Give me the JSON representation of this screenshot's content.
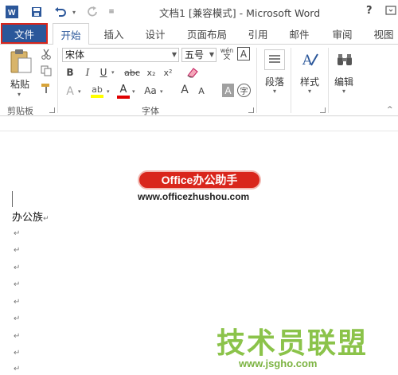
{
  "window": {
    "title": "文档1 [兼容模式] - Microsoft Word",
    "help": "?",
    "app_icon": "word-app-icon"
  },
  "quick_access": {
    "save_icon": "save-icon",
    "undo_icon": "undo-icon",
    "redo_icon": "redo-icon",
    "customize_icon": "customize-qat-icon"
  },
  "tabs": [
    "开始",
    "插入",
    "设计",
    "页面布局",
    "引用",
    "邮件",
    "审阅",
    "视图"
  ],
  "file_tab": "文件",
  "ribbon": {
    "clipboard": {
      "paste": "粘贴",
      "label": "剪贴板"
    },
    "font": {
      "font_name": "宋体",
      "font_size": "五号",
      "label": "字体",
      "bold": "B",
      "italic": "I",
      "underline": "U",
      "strike": "abc",
      "subscript": "x₂",
      "superscript": "x²",
      "grow": "A",
      "shrink": "A",
      "case": "Aa",
      "wen": "wén",
      "char_border": "A",
      "char_shading": "A",
      "enclose": "字"
    },
    "paragraph": {
      "label": "段落"
    },
    "styles": {
      "label": "样式"
    },
    "editing": {
      "label": "编辑"
    }
  },
  "colors": {
    "accent": "#2b579a",
    "file_border": "#d9261c",
    "highlight": "#ffff00",
    "font_color": "#e00000"
  },
  "document": {
    "text": "办公族",
    "paragraph_mark": "↵"
  },
  "watermarks": {
    "badge": "Office办公助手",
    "url": "www.officezhushou.com",
    "site_name": "技术员联盟",
    "site_url": "www.jsgho.com"
  }
}
